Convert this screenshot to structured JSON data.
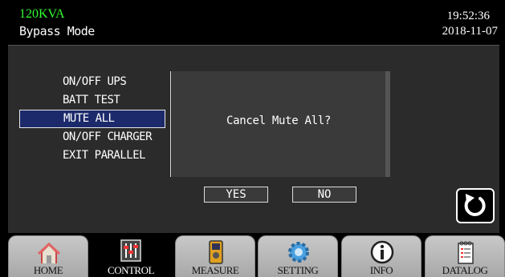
{
  "header": {
    "model": "120KVA",
    "mode": "Bypass Mode",
    "time": "19:52:36",
    "date": "2018-11-07"
  },
  "menu": {
    "items": [
      {
        "label": "ON/OFF UPS"
      },
      {
        "label": "BATT TEST"
      },
      {
        "label": "MUTE ALL"
      },
      {
        "label": "ON/OFF CHARGER"
      },
      {
        "label": "EXIT PARALLEL"
      }
    ]
  },
  "dialog": {
    "message": "Cancel Mute All?",
    "yes_label": "YES",
    "no_label": "NO"
  },
  "nav": {
    "tabs": [
      {
        "label": "HOME",
        "icon": "home-icon"
      },
      {
        "label": "CONTROL",
        "icon": "sliders-icon"
      },
      {
        "label": "MEASURE",
        "icon": "meter-icon"
      },
      {
        "label": "SETTING",
        "icon": "gear-icon"
      },
      {
        "label": "INFO",
        "icon": "info-icon"
      },
      {
        "label": "DATALOG",
        "icon": "notepad-icon"
      }
    ]
  },
  "colors": {
    "model_text": "#33ff33",
    "selected_bg": "#1c2a6b",
    "panel_bg": "#2b2b2b"
  }
}
